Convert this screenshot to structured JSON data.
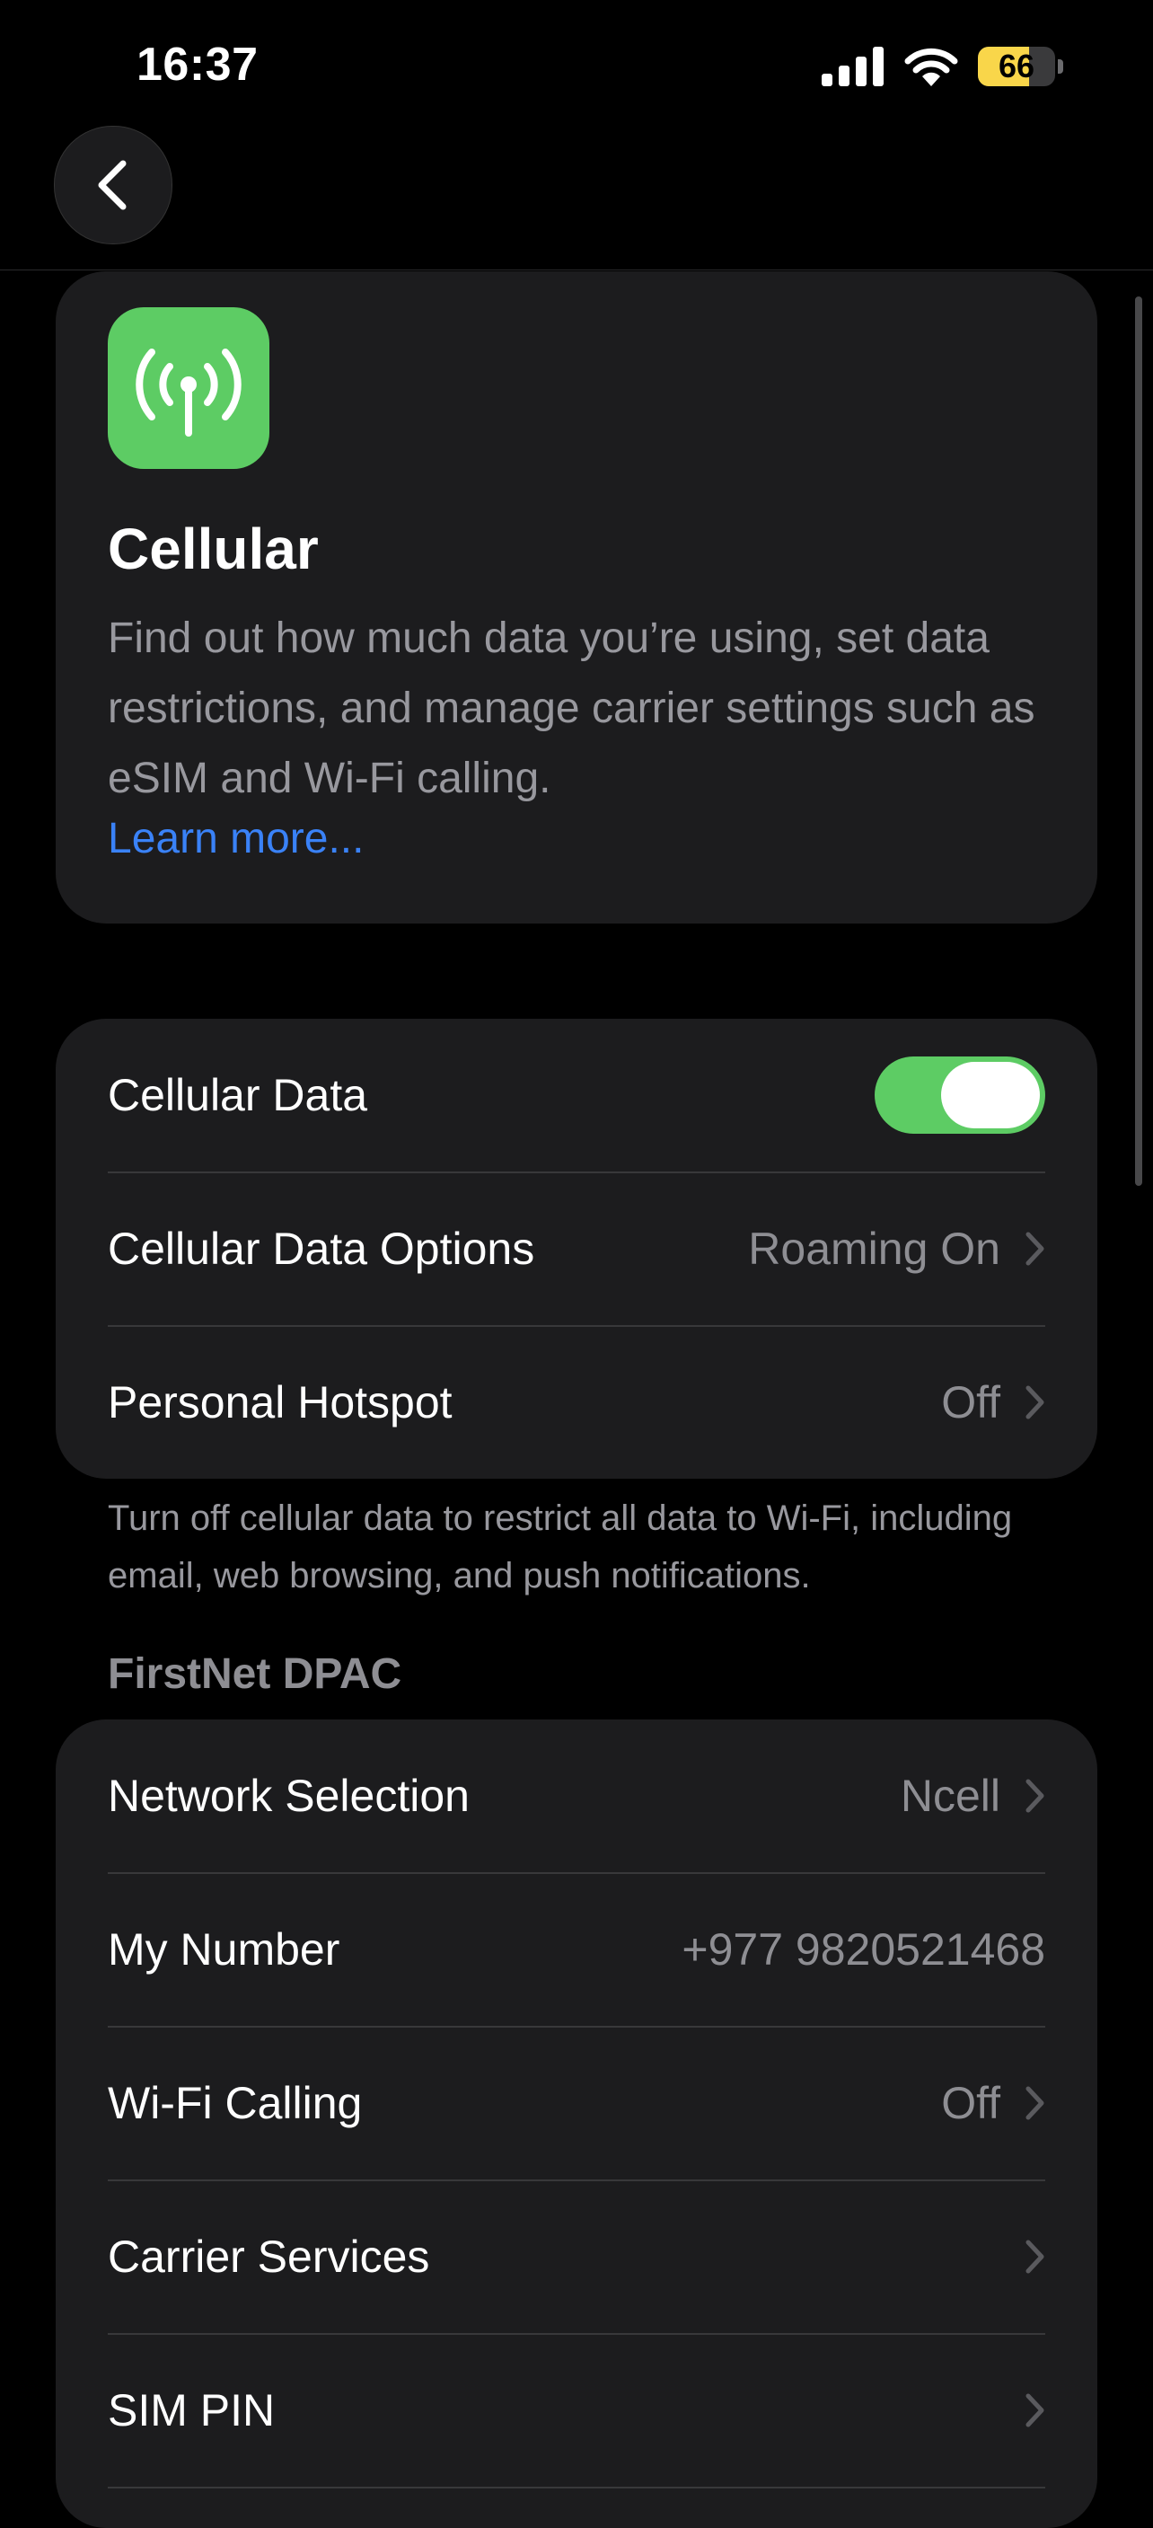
{
  "status_bar": {
    "time": "16:37",
    "battery_level": "66",
    "battery_fraction": 0.66,
    "icons": [
      "signal-icon",
      "wifi-icon",
      "battery-icon"
    ]
  },
  "nav": {
    "back_icon": "chevron-left-icon"
  },
  "intro": {
    "icon": "antenna-icon",
    "icon_color": "#5dcc64",
    "title": "Cellular",
    "description": "Find out how much data you’re using, set data restrictions, and manage carrier settings such as eSIM and Wi-Fi calling.",
    "learn_more": "Learn more..."
  },
  "cellular_group": {
    "rows": [
      {
        "label": "Cellular Data",
        "toggle_on": true
      },
      {
        "label": "Cellular Data Options",
        "value": "Roaming On"
      },
      {
        "label": "Personal Hotspot",
        "value": "Off"
      }
    ],
    "footer": "Turn off cellular data to restrict all data to Wi-Fi, including email, web browsing, and push notifications."
  },
  "carrier_group": {
    "header": "FirstNet DPAC",
    "rows": [
      {
        "label": "Network Selection",
        "value": "Ncell"
      },
      {
        "label": "My Number",
        "value": "+977 9820521468"
      },
      {
        "label": "Wi-Fi Calling",
        "value": "Off"
      },
      {
        "label": "Carrier Services",
        "value": ""
      },
      {
        "label": "SIM PIN",
        "value": ""
      }
    ]
  },
  "colors": {
    "accent_green": "#5dcc64",
    "link_blue": "#3a82f7",
    "battery_yellow": "#f9d64a"
  }
}
